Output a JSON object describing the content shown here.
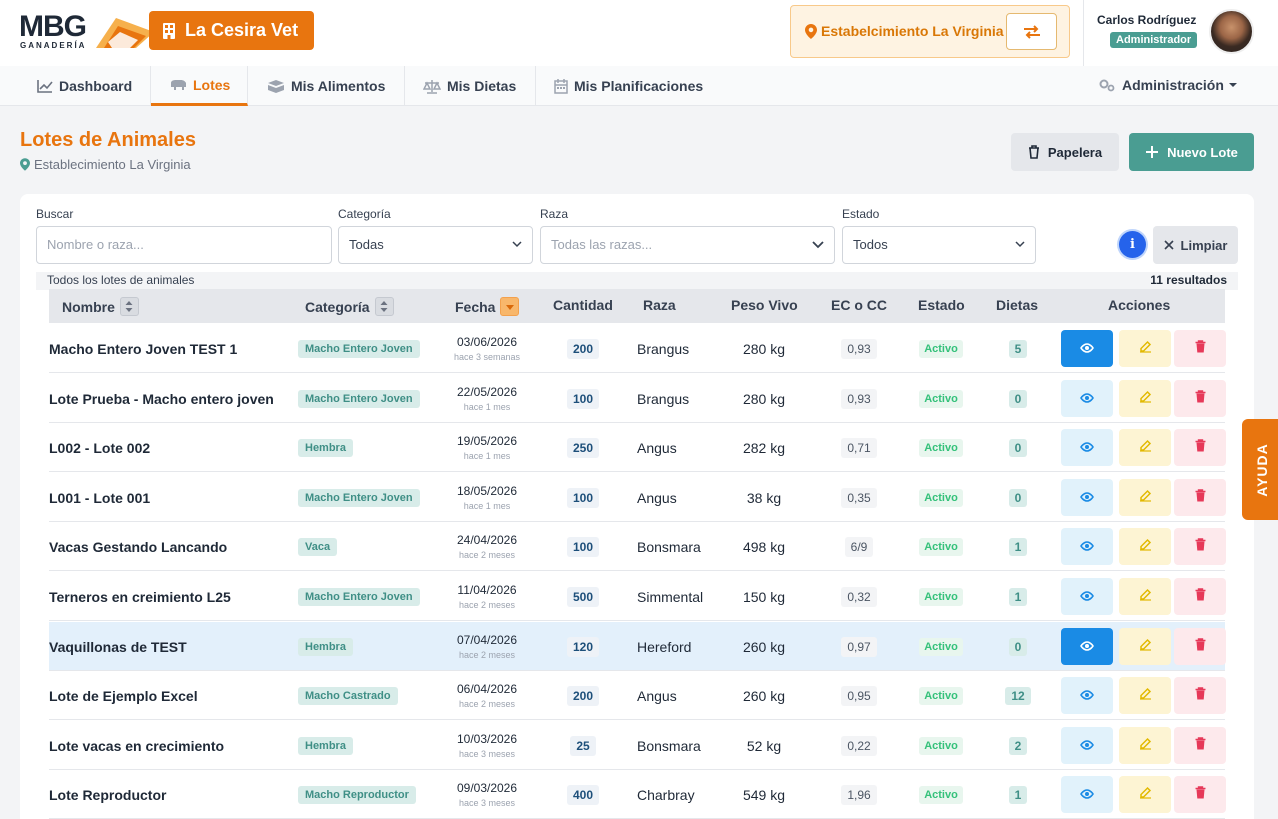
{
  "brand": {
    "logo_text": "MBG",
    "logo_sub": "GANADERÍA",
    "clinic": "La Cesira Vet"
  },
  "establishment": {
    "label": "Estabelcimiento La Virginia"
  },
  "user": {
    "name": "Carlos Rodríguez",
    "role": "Administrador"
  },
  "nav": {
    "items": [
      {
        "label": "Dashboard",
        "icon": "chart-line-icon"
      },
      {
        "label": "Lotes",
        "icon": "cattle-icon"
      },
      {
        "label": "Mis Alimentos",
        "icon": "feed-icon"
      },
      {
        "label": "Mis Dietas",
        "icon": "scale-icon"
      },
      {
        "label": "Mis Planificaciones",
        "icon": "calendar-icon"
      }
    ],
    "admin": "Administración"
  },
  "page": {
    "title": "Lotes de Animales",
    "subtitle": "Establecimiento La Virginia",
    "papelera": "Papelera",
    "nuevo": "Nuevo Lote"
  },
  "filters": {
    "buscar_label": "Buscar",
    "buscar_placeholder": "Nombre o raza...",
    "categoria_label": "Categoría",
    "categoria_value": "Todas",
    "raza_label": "Raza",
    "raza_value": "Todas las razas...",
    "estado_label": "Estado",
    "estado_value": "Todos",
    "limpiar": "Limpiar"
  },
  "meta": {
    "left": "Todos los lotes de animales",
    "right": "11 resultados"
  },
  "table": {
    "headers": {
      "nombre": "Nombre",
      "categoria": "Categoría",
      "fecha": "Fecha",
      "cantidad": "Cantidad",
      "raza": "Raza",
      "peso": "Peso Vivo",
      "ec": "EC o CC",
      "estado": "Estado",
      "dietas": "Dietas",
      "acciones": "Acciones"
    },
    "rows": [
      {
        "nombre": "Macho Entero Joven TEST 1",
        "categoria": "Macho Entero Joven",
        "fecha": "03/06/2026",
        "rel": "hace 3 semanas",
        "cantidad": "200",
        "raza": "Brangus",
        "peso": "280 kg",
        "ec": "0,93",
        "estado": "Activo",
        "dietas": "5"
      },
      {
        "nombre": "Lote Prueba - Macho entero joven",
        "categoria": "Macho Entero Joven",
        "fecha": "22/05/2026",
        "rel": "hace 1 mes",
        "cantidad": "100",
        "raza": "Brangus",
        "peso": "280 kg",
        "ec": "0,93",
        "estado": "Activo",
        "dietas": "0"
      },
      {
        "nombre": "L002 - Lote 002",
        "categoria": "Hembra",
        "fecha": "19/05/2026",
        "rel": "hace 1 mes",
        "cantidad": "250",
        "raza": "Angus",
        "peso": "282 kg",
        "ec": "0,71",
        "estado": "Activo",
        "dietas": "0"
      },
      {
        "nombre": "L001 - Lote 001",
        "categoria": "Macho Entero Joven",
        "fecha": "18/05/2026",
        "rel": "hace 1 mes",
        "cantidad": "100",
        "raza": "Angus",
        "peso": "38 kg",
        "ec": "0,35",
        "estado": "Activo",
        "dietas": "0"
      },
      {
        "nombre": "Vacas Gestando Lancando",
        "categoria": "Vaca",
        "fecha": "24/04/2026",
        "rel": "hace 2 meses",
        "cantidad": "100",
        "raza": "Bonsmara",
        "peso": "498 kg",
        "ec": "6/9",
        "estado": "Activo",
        "dietas": "1"
      },
      {
        "nombre": "Terneros en creimiento L25",
        "categoria": "Macho Entero Joven",
        "fecha": "11/04/2026",
        "rel": "hace 2 meses",
        "cantidad": "500",
        "raza": "Simmental",
        "peso": "150 kg",
        "ec": "0,32",
        "estado": "Activo",
        "dietas": "1"
      },
      {
        "nombre": "Vaquillonas de TEST",
        "categoria": "Hembra",
        "fecha": "07/04/2026",
        "rel": "hace 2 meses",
        "cantidad": "120",
        "raza": "Hereford",
        "peso": "260 kg",
        "ec": "0,97",
        "estado": "Activo",
        "dietas": "0"
      },
      {
        "nombre": "Lote de Ejemplo Excel",
        "categoria": "Macho Castrado",
        "fecha": "06/04/2026",
        "rel": "hace 2 meses",
        "cantidad": "200",
        "raza": "Angus",
        "peso": "260 kg",
        "ec": "0,95",
        "estado": "Activo",
        "dietas": "12"
      },
      {
        "nombre": "Lote vacas en crecimiento",
        "categoria": "Hembra",
        "fecha": "10/03/2026",
        "rel": "hace 3 meses",
        "cantidad": "25",
        "raza": "Bonsmara",
        "peso": "52 kg",
        "ec": "0,22",
        "estado": "Activo",
        "dietas": "2"
      },
      {
        "nombre": "Lote Reproductor",
        "categoria": "Macho Reproductor",
        "fecha": "09/03/2026",
        "rel": "hace 3 meses",
        "cantidad": "400",
        "raza": "Charbray",
        "peso": "549 kg",
        "ec": "1,96",
        "estado": "Activo",
        "dietas": "1"
      }
    ]
  },
  "ayuda": "AYUDA",
  "colors": {
    "brand": "#e8750f",
    "teal": "#4a9d92",
    "view": "#1a8be5"
  }
}
